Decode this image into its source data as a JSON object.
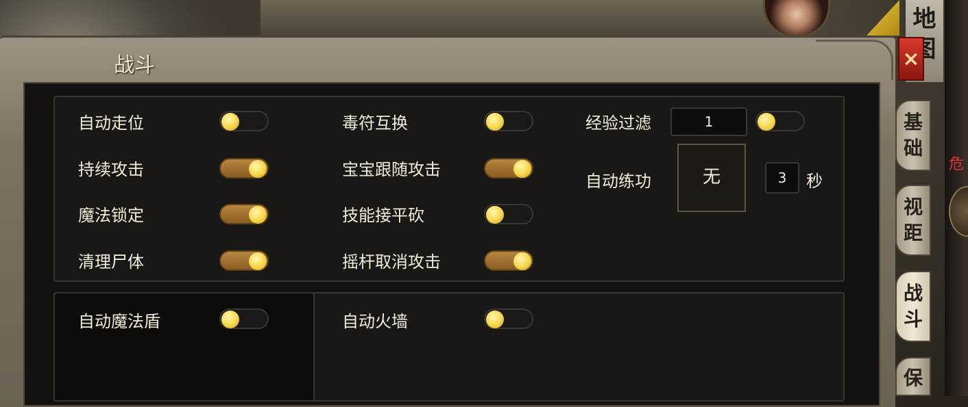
{
  "panel": {
    "title": "战斗"
  },
  "close_button": {
    "label": "×"
  },
  "map_tab": {
    "chars": [
      "地",
      "图"
    ]
  },
  "side_tabs": [
    {
      "chars": [
        "基",
        "础"
      ],
      "active": false
    },
    {
      "chars": [
        "视",
        "距"
      ],
      "active": false
    },
    {
      "chars": [
        "战",
        "斗"
      ],
      "active": true
    },
    {
      "chars": [
        "保"
      ],
      "active": false
    }
  ],
  "danger_text": "危",
  "settings": [
    {
      "label": "自动走位",
      "on": false
    },
    {
      "label": "持续攻击",
      "on": true
    },
    {
      "label": "魔法锁定",
      "on": true
    },
    {
      "label": "清理尸体",
      "on": true
    },
    {
      "label": "毒符互换",
      "on": false
    },
    {
      "label": "宝宝跟随攻击",
      "on": true
    },
    {
      "label": "技能接平砍",
      "on": false
    },
    {
      "label": "摇杆取消攻击",
      "on": true
    }
  ],
  "exp_filter": {
    "label": "经验过滤",
    "value": "1",
    "on": false
  },
  "auto_practice": {
    "label": "自动练功",
    "skill": "无",
    "seconds": "3",
    "unit": "秒"
  },
  "section2": [
    {
      "label": "自动魔法盾",
      "on": false
    },
    {
      "label": "自动火墙",
      "on": false
    }
  ]
}
